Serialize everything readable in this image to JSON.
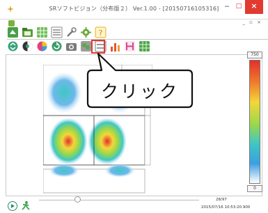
{
  "window": {
    "title": "SRソフトビジョン（分布版２） Ver.1.00 - [20150716105316]",
    "minimize_label": "‒",
    "maximize_label": "□",
    "close_label": "×",
    "mdi_controls": "_ ▫ ×"
  },
  "callout": {
    "label": "クリック"
  },
  "scale": {
    "max_label": "750",
    "min_label": "0"
  },
  "status": {
    "frame_counter": "28/97",
    "timestamp": "2015/07/16 10:53:20.900"
  },
  "toolbar1": [
    {
      "name": "open-icon",
      "color": "#4a9f4a"
    },
    {
      "name": "folder-icon",
      "color": "#5a9c3c"
    },
    {
      "name": "grid-icon",
      "color": "#6fbf5a"
    },
    {
      "name": "list-icon",
      "color": "#8a8a8a"
    },
    {
      "name": "tools-icon",
      "color": "#7a7a7a"
    },
    {
      "name": "settings-icon",
      "color": "#6ca83a"
    },
    {
      "name": "help-icon",
      "color": "#e0b12a"
    }
  ],
  "toolbar2": [
    {
      "name": "toggle-icon",
      "color": "#37a37a"
    },
    {
      "name": "rotate-icon",
      "color": "#333333"
    },
    {
      "name": "color-map-icon",
      "color": "#e0427a"
    },
    {
      "name": "refresh-icon",
      "color": "#3a9c6a"
    },
    {
      "name": "camera-icon",
      "color": "#7a7a7a"
    },
    {
      "name": "distribution-icon",
      "color": "#5aa84a"
    },
    {
      "name": "lines-icon",
      "color": "#7a7a7a"
    },
    {
      "name": "chart-icon",
      "color": "#e05a2a"
    },
    {
      "name": "split-icon",
      "color": "#d04a8a"
    },
    {
      "name": "grid-view-icon",
      "color": "#4aa84a"
    }
  ],
  "colors": {
    "accent": "#e23a2e",
    "heat_low": "#3b9fe0",
    "heat_mid": "#9ad84a",
    "heat_high": "#e2302c"
  }
}
